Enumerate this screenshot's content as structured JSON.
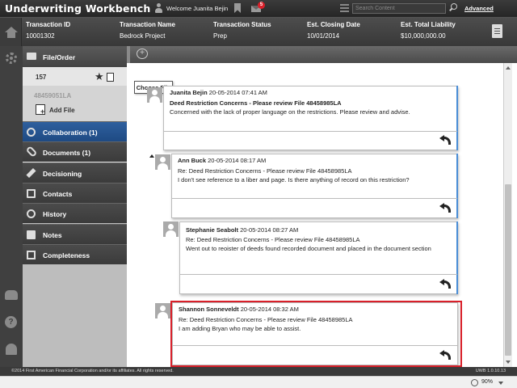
{
  "app": {
    "title": "Underwriting Workbench",
    "welcome": "Welcome Juanita Bejin",
    "mail_count": "5",
    "search_placeholder": "Search Content",
    "advanced_label": "Advanced"
  },
  "transaction": {
    "columns": [
      {
        "label": "Transaction ID",
        "value": "10001302"
      },
      {
        "label": "Transaction Name",
        "value": "Bedrock Project"
      },
      {
        "label": "Transaction Status",
        "value": "Prep"
      },
      {
        "label": "Est. Closing Date",
        "value": "10/01/2014"
      },
      {
        "label": "Est. Total Liability",
        "value": "$10,000,000.00"
      }
    ]
  },
  "nav": {
    "file_order_label": "File/Order",
    "file_number": "157",
    "file_id": "48459051LA",
    "add_file_label": "Add File",
    "items": [
      {
        "label": "Collaboration (1)"
      },
      {
        "label": "Documents (1)"
      },
      {
        "label": "Decisioning"
      },
      {
        "label": "Contacts"
      },
      {
        "label": "History"
      },
      {
        "label": "Notes"
      },
      {
        "label": "Completeness"
      }
    ]
  },
  "main": {
    "choose_file_label": "Choose File",
    "comments": [
      {
        "author": "Juanita Bejin",
        "timestamp": "20-05-2014 07:41 AM",
        "title": "Deed Restriction Concerns - Please review File 48458985LA",
        "body": "Concerned with the lack of proper language on the restrictions. Please review and advise."
      },
      {
        "author": "Ann Buck",
        "timestamp": "20-05-2014 08:17 AM",
        "title": "Re: Deed Restriction Concerns - Please review File 48458985LA",
        "body": "I don't see reference to a liber and page. Is there anything of record on this restriction?"
      },
      {
        "author": "Stephanie Seabolt",
        "timestamp": "20-05-2014 08:27 AM",
        "title": "Re: Deed Restriction Concerns - Please review File 48458985LA",
        "body": "Went out to reoister of deeds found recorded document and placed in the document section"
      },
      {
        "author": "Shannon Sonneveldt",
        "timestamp": "20-05-2014 08:32 AM",
        "title": "Re: Deed Restriction Concerns - Please review File 48458985LA",
        "body": "I am adding Bryan who may be able to assist."
      }
    ]
  },
  "footer": {
    "copyright": "©2014 First American Financial Corporation and/or its affiliates. All rights reserved.",
    "version": "UWB 1.0.10.13"
  },
  "statusbar": {
    "zoom": "90%"
  },
  "colors": {
    "accent_blue": "#1e4a83",
    "highlight_red": "#d9202a",
    "badge_red": "#d9202a"
  }
}
